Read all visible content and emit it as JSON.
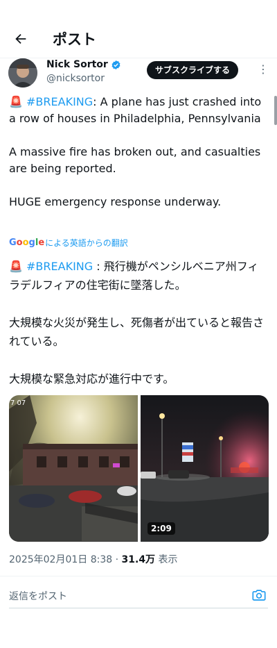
{
  "header": {
    "title": "ポスト",
    "back_icon": "arrow-left-icon"
  },
  "author": {
    "name": "Nick Sortor",
    "handle": "@nicksortor",
    "verified_color": "#1d9bf0",
    "subscribe_label": "サブスクライブする",
    "more_label": "⋮"
  },
  "tweet": {
    "siren": "🚨",
    "hashtag": "#BREAKING",
    "en_line1": ": A plane has just crashed into a row of houses in Philadelphia, Pennsylvania",
    "en_para2": "A massive fire has broken out, and casualties are being reported.",
    "en_para3": "HUGE emergency response underway.",
    "translate_suffix": "による英語からの翻訳",
    "ja_line1": " : 飛行機がペンシルベニア州フィラデルフィアの住宅街に墜落した。",
    "ja_para2": "大規模な火災が発生し、死傷者が出ていると報告されている。",
    "ja_para3": "大規模な緊急対応が進行中です。"
  },
  "media": {
    "video_duration": "2:09",
    "left_overlay": "7 07"
  },
  "meta": {
    "datetime": "2025年02月01日 8:38",
    "separator": "·",
    "views_count": "31.4万",
    "views_label": "表示"
  },
  "reply": {
    "placeholder": "返信をポスト"
  },
  "colors": {
    "accent": "#1d9bf0",
    "text": "#0f1419",
    "muted": "#536471"
  }
}
